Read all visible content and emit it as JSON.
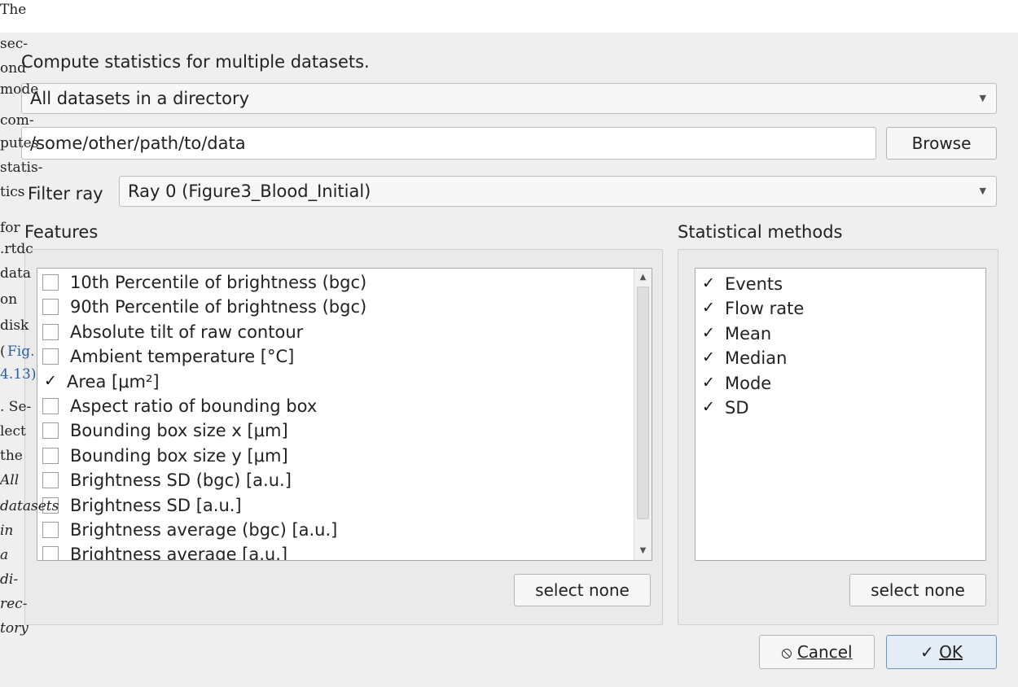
{
  "dialog": {
    "heading": "Compute statistics for multiple datasets.",
    "mode_select": {
      "value": "All datasets in a directory"
    },
    "path_input": {
      "value": "/some/other/path/to/data"
    },
    "browse_label": "Browse",
    "filter_ray": {
      "label": "Filter ray",
      "value": "Ray 0 (Figure3_Blood_Initial)"
    },
    "features": {
      "title": "Features",
      "items": [
        {
          "label": "10th Percentile of brightness (bgc)",
          "checked": false
        },
        {
          "label": "90th Percentile of brightness (bgc)",
          "checked": false
        },
        {
          "label": "Absolute tilt of raw contour",
          "checked": false
        },
        {
          "label": "Ambient temperature [°C]",
          "checked": false
        },
        {
          "label": "Area [μm²]",
          "checked": true
        },
        {
          "label": "Aspect ratio of bounding box",
          "checked": false
        },
        {
          "label": "Bounding box size x [μm]",
          "checked": false
        },
        {
          "label": "Bounding box size y [μm]",
          "checked": false
        },
        {
          "label": "Brightness SD (bgc) [a.u.]",
          "checked": false
        },
        {
          "label": "Brightness SD [a.u.]",
          "checked": false
        },
        {
          "label": "Brightness average (bgc) [a.u.]",
          "checked": false
        },
        {
          "label": "Brightness average [a.u.]",
          "checked": false
        }
      ],
      "select_none": "select none"
    },
    "methods": {
      "title": "Statistical methods",
      "items": [
        {
          "label": "Events",
          "checked": true
        },
        {
          "label": "Flow rate",
          "checked": true
        },
        {
          "label": "Mean",
          "checked": true
        },
        {
          "label": "Median",
          "checked": true
        },
        {
          "label": "Mode",
          "checked": true
        },
        {
          "label": "SD",
          "checked": true
        }
      ],
      "select_none": "select none"
    },
    "cancel_label": "Cancel",
    "ok_label": "OK",
    "check_glyph": "✓",
    "cancel_icon": "⦸",
    "ok_icon": "✓"
  },
  "prose": {
    "lines": [
      "The",
      "sec-",
      "ond",
      "mode",
      "com-",
      "putes",
      "statis-",
      "tics",
      "for",
      ".rtdc",
      "data",
      "on",
      "disk",
      "(",
      "Fig.",
      "4.13)",
      ". Se-",
      "lect",
      "the",
      "All",
      "datasets",
      "in",
      "a",
      "di-",
      "rec-",
      "tory"
    ]
  }
}
